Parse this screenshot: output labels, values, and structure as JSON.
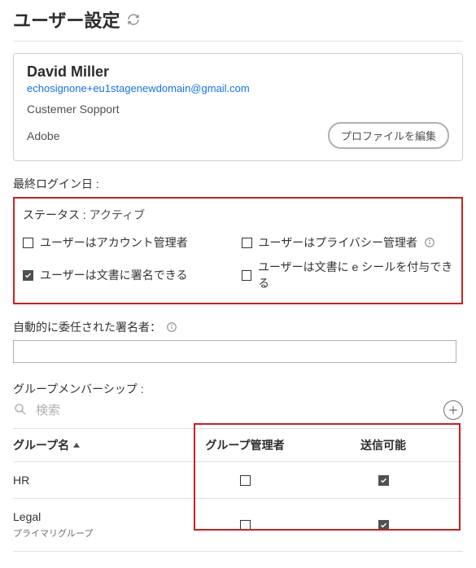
{
  "page": {
    "title": "ユーザー設定"
  },
  "user": {
    "name": "David Miller",
    "email": "echosignone+eu1stagenewdomain@gmail.com",
    "role": "Custemer Sopport",
    "company": "Adobe",
    "edit_profile_label": "プロファイルを編集"
  },
  "labels": {
    "last_login": "最終ログイン日",
    "status": "ステータス",
    "status_value": "アクティブ",
    "auto_delegate": "自動的に委任された署名者：",
    "group_membership": "グループメンバーシップ",
    "group_name": "グループ名",
    "group_admin": "グループ管理者",
    "can_send": "送信可能",
    "search_placeholder": "検索",
    "primary_group": "プライマリグループ"
  },
  "permissions": [
    {
      "label": "ユーザーはアカウント管理者",
      "checked": false,
      "info": false
    },
    {
      "label": "ユーザーはプライバシー管理者",
      "checked": false,
      "info": true
    },
    {
      "label": "ユーザーは文書に署名できる",
      "checked": true,
      "info": false
    },
    {
      "label": "ユーザーは文書に e シールを付与できる",
      "checked": false,
      "info": false
    }
  ],
  "groups": [
    {
      "name": "HR",
      "admin": false,
      "can_send": true,
      "primary": false
    },
    {
      "name": "Legal",
      "admin": false,
      "can_send": true,
      "primary": true
    }
  ]
}
